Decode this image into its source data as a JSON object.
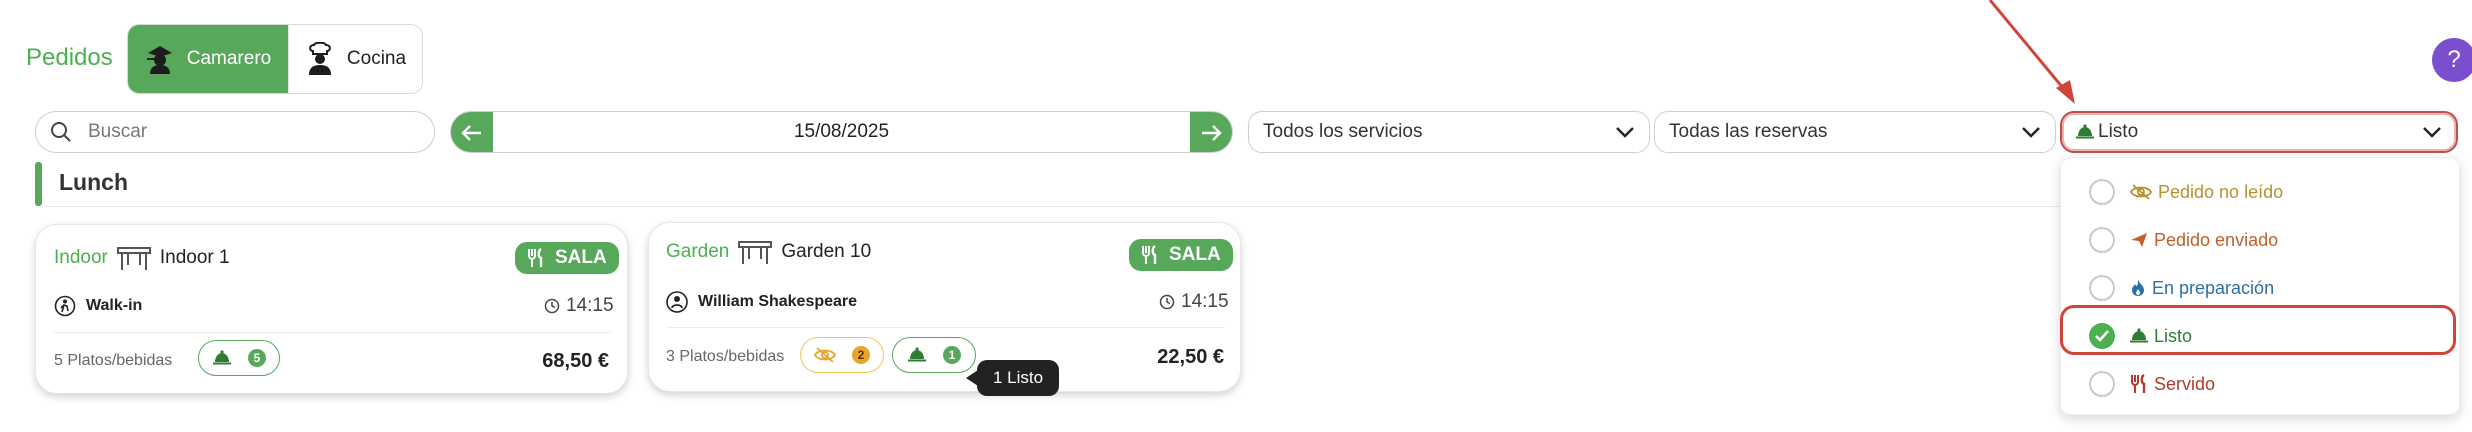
{
  "header": {
    "title": "Pedidos",
    "tabs": [
      {
        "label": "Camarero",
        "icon": "waiter-icon",
        "active": true
      },
      {
        "label": "Cocina",
        "icon": "chef-icon",
        "active": false
      }
    ],
    "help_label": "?"
  },
  "toolbar": {
    "search_placeholder": "Buscar",
    "date": "15/08/2025",
    "services_value": "Todos los servicios",
    "reservations_value": "Todas las reservas",
    "status_value": "Listo"
  },
  "section": {
    "title": "Lunch"
  },
  "cards": [
    {
      "zone": "Indoor",
      "table": "Indoor 1",
      "type": "SALA",
      "guest": "Walk-in",
      "time": "14:15",
      "items": "5 Platos/bebidas",
      "ready_count": "5",
      "price": "68,50 €"
    },
    {
      "zone": "Garden",
      "table": "Garden 10",
      "type": "SALA",
      "guest": "William Shakespeare",
      "time": "14:15",
      "items": "3 Platos/bebidas",
      "unread_count": "2",
      "ready_count": "1",
      "price": "22,50 €"
    }
  ],
  "tooltip": "1 Listo",
  "status_options": [
    {
      "label": "Pedido no leído",
      "color": "#b8902e",
      "checked": false
    },
    {
      "label": "Pedido enviado",
      "color": "#c0602a",
      "checked": false
    },
    {
      "label": "En preparación",
      "color": "#2f6fa8",
      "checked": false
    },
    {
      "label": "Listo",
      "color": "#2e7d32",
      "checked": true
    },
    {
      "label": "Servido",
      "color": "#b03a2e",
      "checked": false
    }
  ],
  "colors": {
    "accent": "#58a85c",
    "highlight": "#d0453a",
    "help": "#7a4ecf"
  }
}
